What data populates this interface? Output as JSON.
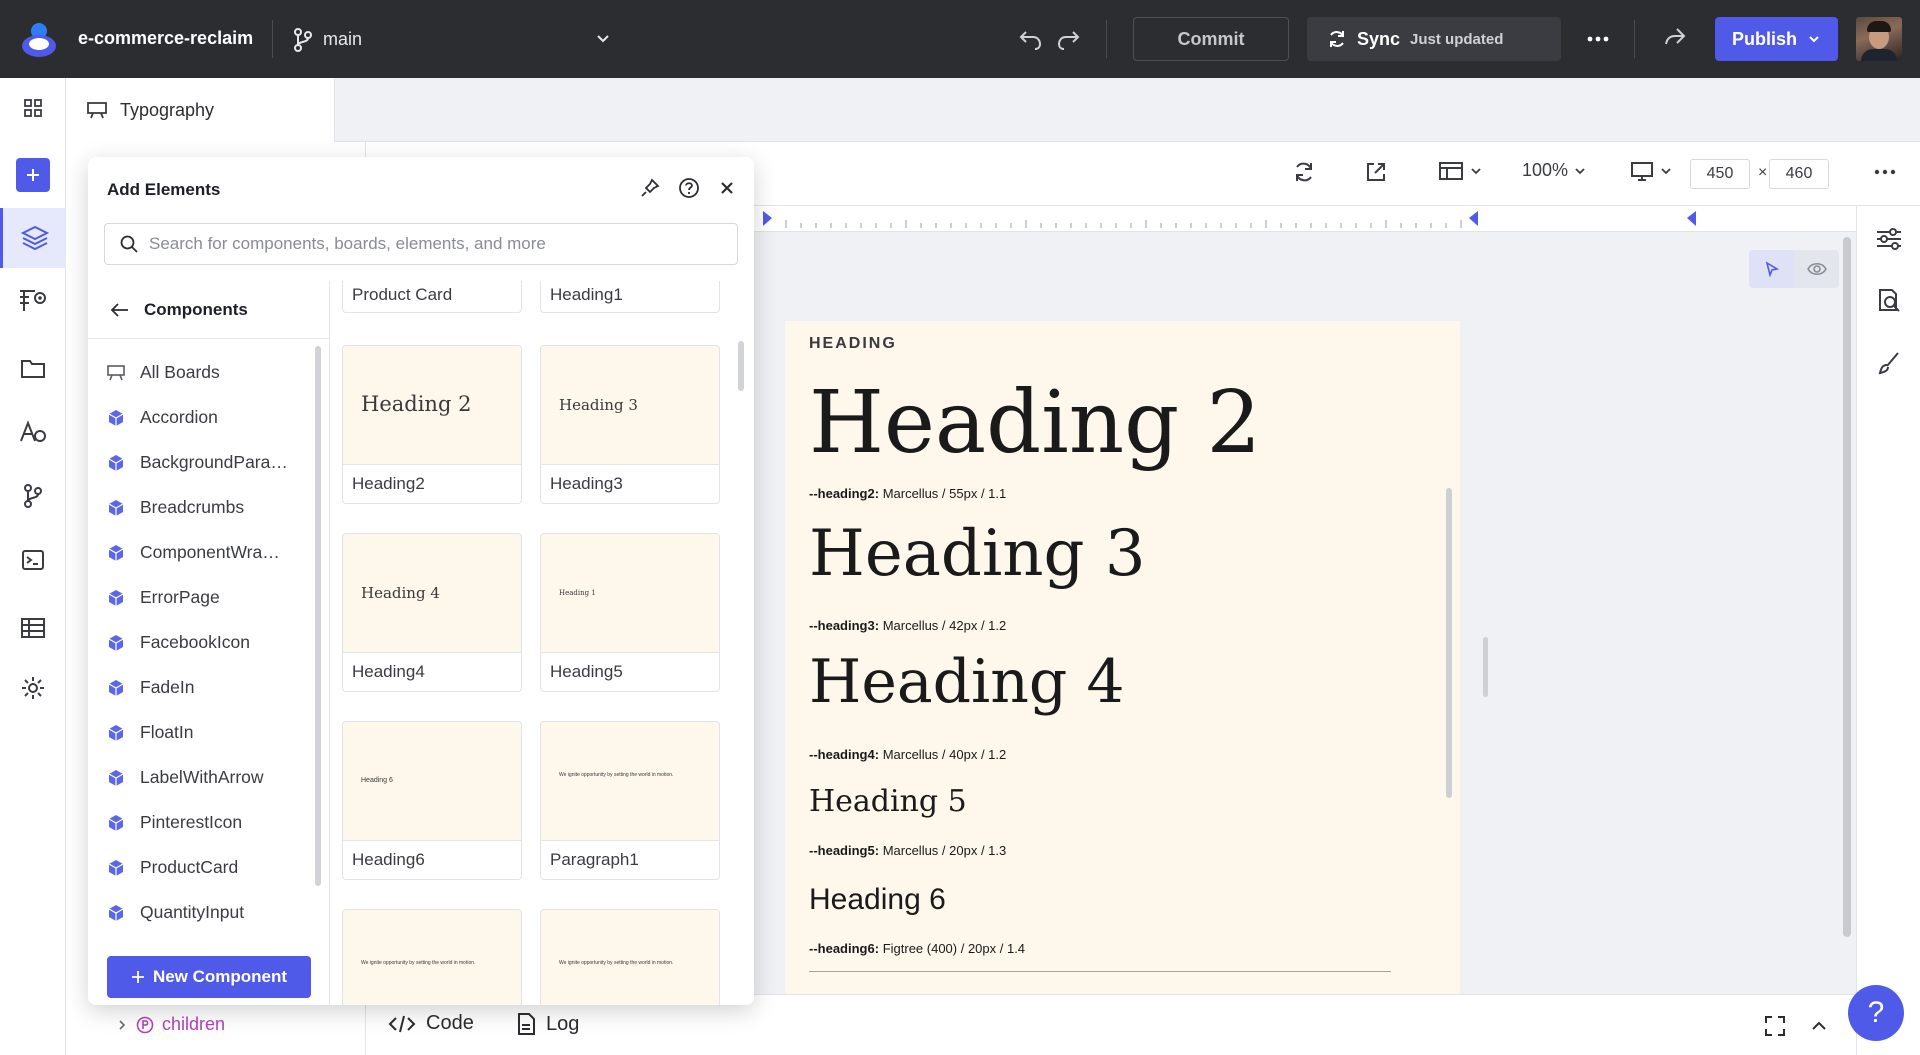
{
  "app": {
    "project_name": "e-commerce-reclaim",
    "branch": "main",
    "commit_label": "Commit",
    "sync_label": "Sync",
    "sync_status": "Just updated",
    "publish_label": "Publish",
    "accent": "#4f5ae8"
  },
  "tab": {
    "label": "Typography"
  },
  "canvas_toolbar": {
    "zoom": "100%",
    "width": "450",
    "height": "460",
    "times": "×"
  },
  "board": {
    "section_label": "HEADING",
    "samples": [
      {
        "text": "Heading 2",
        "token": "--heading2:",
        "spec": "Marcellus / 55px / 1.1"
      },
      {
        "text": "Heading 3",
        "token": "--heading3:",
        "spec": "Marcellus / 42px / 1.2"
      },
      {
        "text": "Heading 4",
        "token": "--heading4:",
        "spec": "Marcellus / 40px / 1.2"
      },
      {
        "text": "Heading 5",
        "token": "--heading5:",
        "spec": "Marcellus / 20px / 1.3"
      },
      {
        "text": "Heading 6",
        "token": "--heading6:",
        "spec": "Figtree (400) / 20px / 1.4"
      }
    ]
  },
  "panel": {
    "title": "Add Elements",
    "search_placeholder": "Search for components, boards, elements, and more",
    "components_header": "Components",
    "list": [
      "All Boards",
      "Accordion",
      "BackgroundPara…",
      "Breadcrumbs",
      "ComponentWra…",
      "ErrorPage",
      "FacebookIcon",
      "FadeIn",
      "FloatIn",
      "LabelWithArrow",
      "PinterestIcon",
      "ProductCard",
      "QuantityInput"
    ],
    "new_component_label": "New Component",
    "top_cards": [
      "Product Card",
      "Heading1"
    ],
    "cards": [
      {
        "label": "Heading2",
        "thumb": "Heading 2"
      },
      {
        "label": "Heading3",
        "thumb": "Heading 3"
      },
      {
        "label": "Heading4",
        "thumb": "Heading 4"
      },
      {
        "label": "Heading5",
        "thumb": "Heading 1"
      },
      {
        "label": "Heading6",
        "thumb": "Heading 6"
      },
      {
        "label": "Paragraph1",
        "thumb": "We ignite opportunity by setting the world in motion."
      },
      {
        "label": "",
        "thumb": "We ignite opportunity by setting the world in motion."
      },
      {
        "label": "",
        "thumb": "We ignite opportunity by setting the world in motion."
      }
    ]
  },
  "layers": {
    "children_label": "children"
  },
  "bottom": {
    "code_label": "Code",
    "log_label": "Log",
    "help_label": "?"
  }
}
